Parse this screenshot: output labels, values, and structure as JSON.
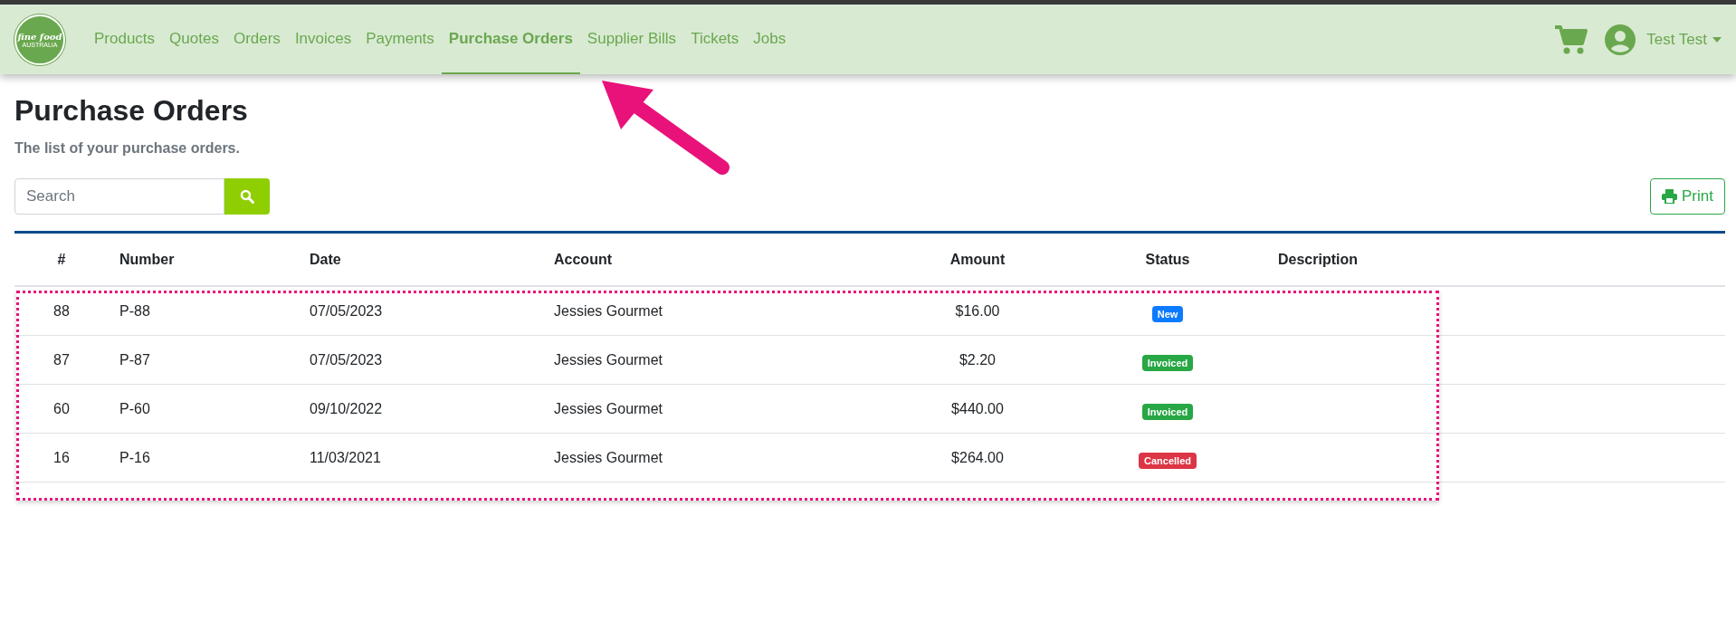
{
  "logo": {
    "line_1": "fine food",
    "line_2": "AUSTRALIA"
  },
  "nav": [
    {
      "label": "Products",
      "selected": false
    },
    {
      "label": "Quotes",
      "selected": false
    },
    {
      "label": "Orders",
      "selected": false
    },
    {
      "label": "Invoices",
      "selected": false
    },
    {
      "label": "Payments",
      "selected": false
    },
    {
      "label": "Purchase Orders",
      "selected": true
    },
    {
      "label": "Supplier Bills",
      "selected": false
    },
    {
      "label": "Tickets",
      "selected": false
    },
    {
      "label": "Jobs",
      "selected": false
    }
  ],
  "user": {
    "name": "Test Test"
  },
  "page": {
    "title": "Purchase Orders",
    "subtitle": "The list of your purchase orders."
  },
  "search": {
    "placeholder": "Search"
  },
  "print_button": "Print",
  "table": {
    "columns": [
      "#",
      "Number",
      "Date",
      "Account",
      "Amount",
      "Status",
      "Description"
    ],
    "rows": [
      {
        "id": "88",
        "number": "P-88",
        "date": "07/05/2023",
        "account": "Jessies Gourmet",
        "amount": "$16.00",
        "status": "New",
        "color": "#0d7bff"
      },
      {
        "id": "87",
        "number": "P-87",
        "date": "07/05/2023",
        "account": "Jessies Gourmet",
        "amount": "$2.20",
        "status": "Invoiced",
        "color": "#28a745"
      },
      {
        "id": "60",
        "number": "P-60",
        "date": "09/10/2022",
        "account": "Jessies Gourmet",
        "amount": "$440.00",
        "status": "Invoiced",
        "color": "#28a745"
      },
      {
        "id": "16",
        "number": "P-16",
        "date": "11/03/2021",
        "account": "Jessies Gourmet",
        "amount": "$264.00",
        "status": "Cancelled",
        "color": "#dc3545"
      }
    ]
  }
}
